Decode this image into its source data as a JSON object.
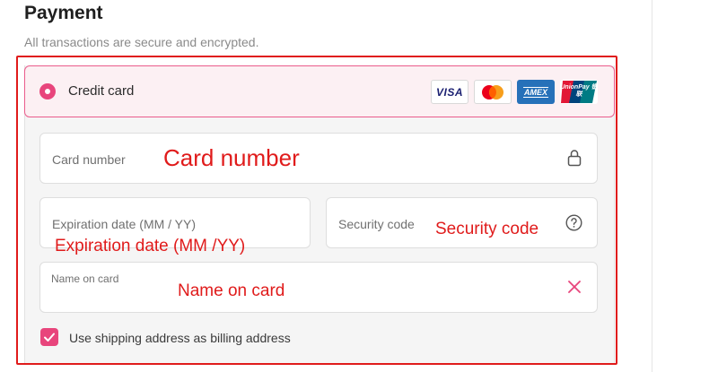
{
  "page": {
    "title": "Payment",
    "subtitle": "All transactions are secure and encrypted."
  },
  "payment_method": {
    "label": "Credit card",
    "selected": true,
    "card_logos": [
      {
        "name": "visa",
        "text": "VISA"
      },
      {
        "name": "mastercard",
        "text": ""
      },
      {
        "name": "amex",
        "text": "AMEX"
      },
      {
        "name": "unionpay",
        "text": "UnionPay 银联"
      }
    ]
  },
  "fields": {
    "card_number": {
      "placeholder": "Card number",
      "icon": "lock-icon"
    },
    "expiration": {
      "placeholder": "Expiration date (MM / YY)"
    },
    "security_code": {
      "placeholder": "Security code",
      "icon": "help-icon"
    },
    "name_on_card": {
      "label": "Name on card",
      "value": "",
      "icon": "close-icon"
    }
  },
  "billing": {
    "checkbox_label": "Use shipping address as billing address",
    "checked": true
  },
  "annotations": {
    "card_number": "Card number",
    "expiration": "Expiration date (MM /YY)",
    "security_code": "Security code",
    "name_on_card": "Name on card"
  },
  "colors": {
    "accent": "#e8457c",
    "annotation": "#e01b1b",
    "selected_bg": "#fcf0f3"
  }
}
